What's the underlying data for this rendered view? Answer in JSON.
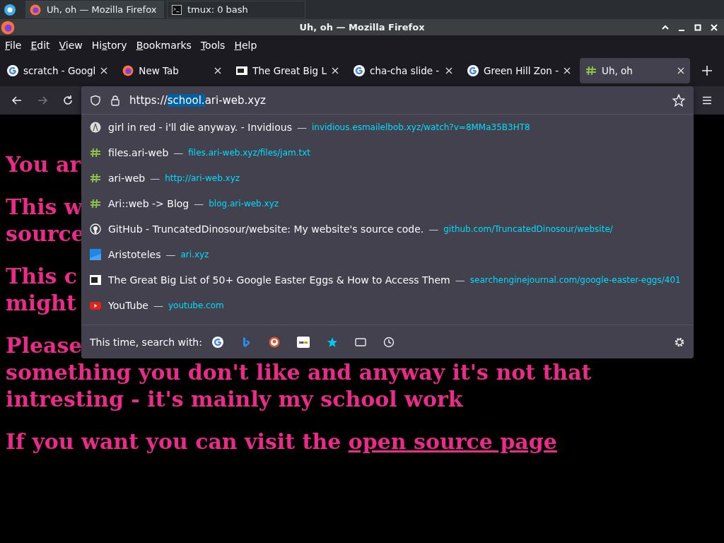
{
  "taskbar": {
    "tasks": [
      {
        "label": "Uh, oh — Mozilla Firefox",
        "selected": true
      },
      {
        "label": "tmux: 0 bash",
        "selected": false
      }
    ]
  },
  "window": {
    "title": "Uh, oh — Mozilla Firefox"
  },
  "menu": [
    {
      "key": "F",
      "after": "ile"
    },
    {
      "key": "E",
      "after": "dit"
    },
    {
      "key": "V",
      "after": "iew"
    },
    {
      "before": "Hi",
      "key": "s",
      "after": "tory"
    },
    {
      "key": "B",
      "after": "ookmarks"
    },
    {
      "key": "T",
      "after": "ools"
    },
    {
      "key": "H",
      "after": "elp"
    }
  ],
  "tabs": [
    {
      "label": "scratch - Googl",
      "selected": false
    },
    {
      "label": "New Tab",
      "selected": false
    },
    {
      "label": "The Great Big L",
      "selected": false
    },
    {
      "label": "cha-cha slide -",
      "selected": false
    },
    {
      "label": "Green Hill Zon -",
      "selected": false
    },
    {
      "label": "Uh, oh",
      "selected": true
    }
  ],
  "urlbar": {
    "before": "https://",
    "selected": "school.",
    "after": "ari-web.xyz"
  },
  "suggestions": [
    {
      "title": "girl in red - i'll die anyway. - Invidious",
      "separator": "—",
      "url": "invidious.esmailelbob.xyz/watch?v=8MMa35B3HT8"
    },
    {
      "title": "files.ari-web",
      "separator": "—",
      "url": "files.ari-web.xyz/files/jam.txt"
    },
    {
      "title": "ari-web",
      "separator": "—",
      "url": "http://ari-web.xyz"
    },
    {
      "title": "Ari::web -> Blog",
      "separator": "—",
      "url": "blog.ari-web.xyz"
    },
    {
      "title": "GitHub - TruncatedDinosour/website: My website's source code.",
      "separator": "—",
      "url": "github.com/TruncatedDinosour/website/"
    },
    {
      "title": "Aristoteles",
      "separator": "—",
      "url": "ari.xyz"
    },
    {
      "title": "The Great Big List of 50+ Google Easter Eggs & How to Access Them",
      "separator": "—",
      "url": "searchenginejournal.com/google-easter-eggs/401"
    },
    {
      "title": "YouTube",
      "separator": "—",
      "url": "youtube.com"
    }
  ],
  "search_with": {
    "label": "This time, search with:"
  },
  "page": {
    "paragraphs": [
      {
        "lines": [
          "You ar"
        ]
      },
      {
        "lines": [
          "This w",
          "source"
        ]
      },
      {
        "lines": [
          "This c",
          "might"
        ]
      },
      {
        "lines": [
          "Please",
          "something you don't like and anyway it's not that",
          "intresting - it's mainly my school work"
        ]
      }
    ],
    "last": {
      "text": "If you want you can visit the ",
      "link": "open source page"
    }
  }
}
